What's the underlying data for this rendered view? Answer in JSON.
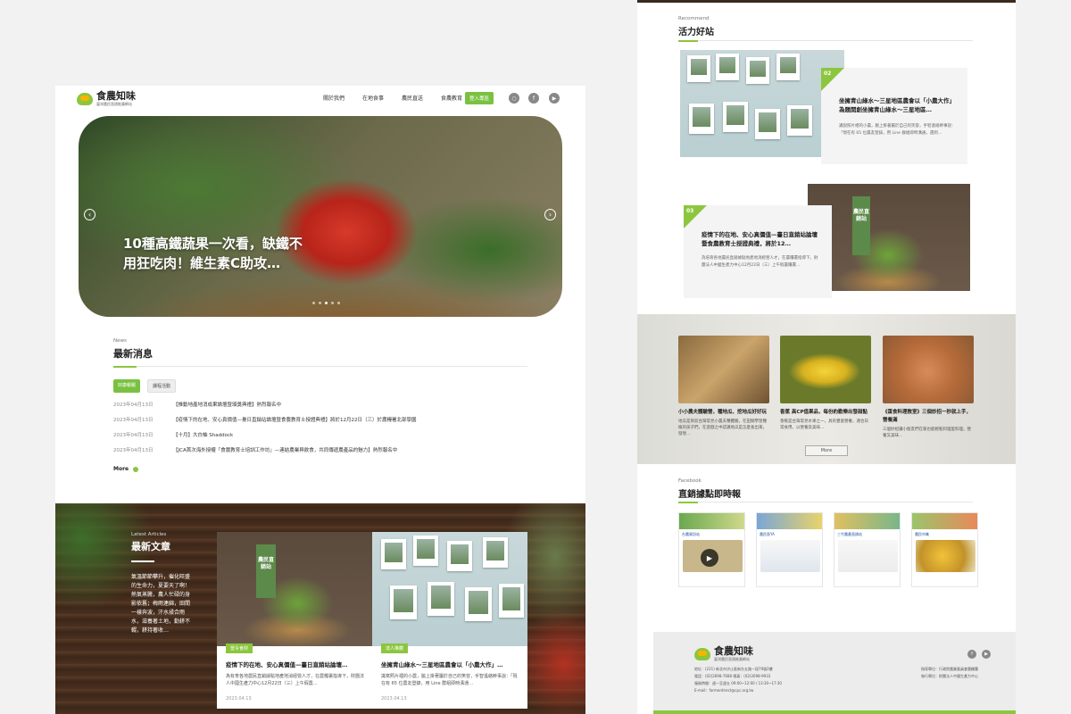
{
  "brand": {
    "name": "食農知味",
    "tagline": "臺灣農民直銷推廣網站"
  },
  "nav": {
    "items": [
      "關於我們",
      "在地食事",
      "農民直送",
      "食農教育"
    ],
    "login": "登入專區"
  },
  "hero": {
    "title": "10種高鐵蔬果一次看，缺鐵不用狂吃肉！維生素C助攻…",
    "prev": "‹",
    "next": "›"
  },
  "news": {
    "eyebrow": "News",
    "title": "最新消息",
    "tabs": [
      "好康報報",
      "課程活動"
    ],
    "items": [
      {
        "date": "2023年04月13日",
        "text": "【推動地產地消成果論壇暨頒獎典禮】熱烈報名中"
      },
      {
        "date": "2023年04月13日",
        "text": "【疫情下的在地、安心真價值—臺日直銷站論壇暨食農教育士授證典禮】將於12月22日（三）於農糧署北部學園"
      },
      {
        "date": "2023年04月13日",
        "text": "【十月】大白柚 Shaddock"
      },
      {
        "date": "2023年04月13日",
        "text": "【JCA首次海外授權「食農教育士培訓工作坊」—連結農業與飲食，共同傳遞農產品的魅力】熱烈報名中"
      }
    ],
    "more": "More"
  },
  "articles": {
    "eyebrow": "Latest Articles",
    "title": "最新文章",
    "desc": "氣溫節節攀升，催化旺盛的生命力，夏要天了啊！熱氣蒸騰，農人忙碌的身影依舊；梅雨連綿，田間一樣奔波，汗水揉合雨水，滋養著土地，勤耕不輟，耕持著收…",
    "cards": [
      {
        "tag": "當令食材",
        "title": "疫情下的在地、安心真價值—臺日直銷站論壇…",
        "desc": "為有育各地農民直銷據點地產地消經營人才，在農糧署指導下，財團法人中國生產力中心12月22日（三）上午假農…",
        "date": "2023.04.13",
        "flag": "農民直銷站"
      },
      {
        "tag": "達人推薦",
        "title": "坐擁青山綠水～三星地區農會以「小農大作」…",
        "desc": "識寫照片裡的小農，脇上掛著屬於自己的笑容，手智遙絡幹事說：「現在有 65 位農友登錄，用 Line 群組即時溝通…",
        "date": "2023.04.13"
      }
    ]
  },
  "events": {
    "eyebrow": "Recommend",
    "title": "活力好站",
    "items": [
      {
        "num": "02",
        "title": "坐擁青山綠水～三星地區農會以「小農大作」為題開創坐擁青山綠水～三星地區…",
        "desc": "識說照片裡的小農，臉上掛著屬於自己的笑容，手智遙絡幹事說：「現在有 65 位農友登錄，用 Line 群組即時溝通，遇到…"
      },
      {
        "num": "03",
        "title": "疫情下的在地、安心真價值—臺日直銷站論壇暨食農教育士授證典禮，將於12…",
        "desc": "為培育各地農民直銷據點地產地消經營人才，在農糧署指導下，財團法人中國生產力中心12月22日（三）上午假農糧署…",
        "flag": "農民直銷站"
      }
    ]
  },
  "market": {
    "items": [
      {
        "title": "小小農夫體驗營，種地瓜、挖地瓜好好玩",
        "desc": "地瓜是目前台灣常見小農夫種體驗，在田間學習種植的孩子們，在遊戲之中認識地瓜是怎麼長出來，發現…"
      },
      {
        "title": "香蕉 高CP值果品，每份約歡樂出發甜點",
        "desc": "香蕉是台灣常見水果之一，具有豐富營養，適合日常食用，以營養及美味…"
      },
      {
        "title": "《蛋食料理教室》三個妙招一秒就上手，營養滿",
        "desc": "三個妙招讓小朋友們在家也能輕鬆料理蛋料理，營養又美味…"
      }
    ],
    "more": "More"
  },
  "facebook": {
    "eyebrow": "Facebook",
    "title": "直銷據點即時報",
    "posts": [
      "台農資訊站",
      "農民直YA",
      "三竹農產直銷站",
      "農民市集"
    ]
  },
  "footer": {
    "brand": "食農知味",
    "tagline": "臺灣農民直銷推廣網站",
    "info": [
      "地址：(221) 新北市汐止區新台五路一段79號2樓",
      "電話：(02)2698-7688 傳真：(02)2698-9933",
      "服務時間：週一至週五 09:00~12:00 / 13:30~17:30",
      "E-mail：farmerdirect@cpc.org.tw"
    ],
    "right": [
      "指導單位：行政院農業委員會農糧署",
      "執行單位：財團法人中國生產力中心"
    ]
  },
  "colors": {
    "accent": "#8cc63f",
    "button": "#7ac142"
  }
}
